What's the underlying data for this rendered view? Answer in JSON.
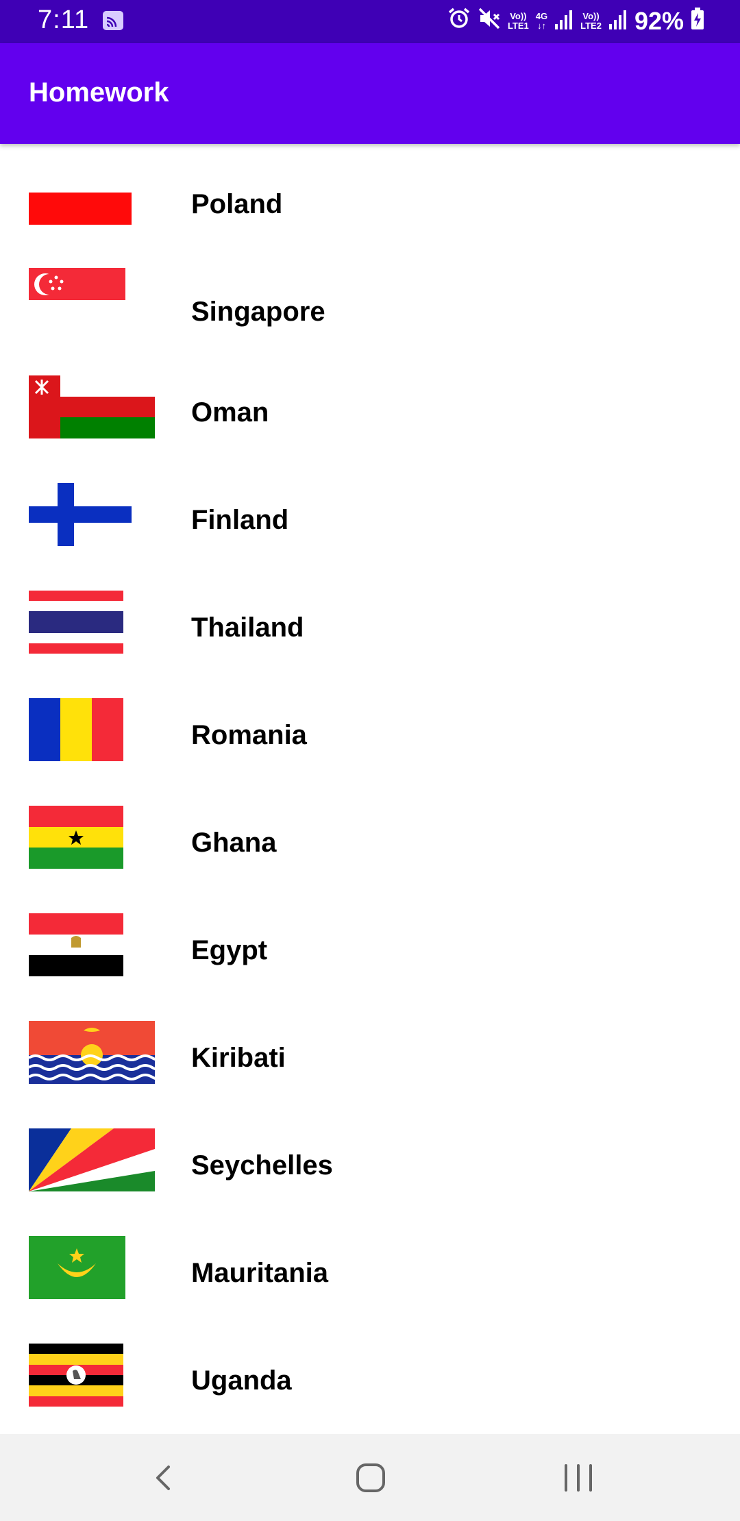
{
  "status_bar": {
    "time": "7:11",
    "battery": "92%",
    "network1_top": "Vo))",
    "network1_bottom": "LTE1",
    "network_type": "4G",
    "network2_top": "Vo))",
    "network2_bottom": "LTE2",
    "icons": [
      "cast-icon",
      "alarm-icon",
      "mute-icon",
      "signal-icon",
      "battery-charging-icon"
    ]
  },
  "app_bar": {
    "title": "Homework"
  },
  "countries": [
    {
      "name": "Poland",
      "flag": "poland-flag-icon"
    },
    {
      "name": "Singapore",
      "flag": "singapore-flag-icon"
    },
    {
      "name": "Oman",
      "flag": "oman-flag-icon"
    },
    {
      "name": "Finland",
      "flag": "finland-flag-icon"
    },
    {
      "name": "Thailand",
      "flag": "thailand-flag-icon"
    },
    {
      "name": "Romania",
      "flag": "romania-flag-icon"
    },
    {
      "name": "Ghana",
      "flag": "ghana-flag-icon"
    },
    {
      "name": "Egypt",
      "flag": "egypt-flag-icon"
    },
    {
      "name": "Kiribati",
      "flag": "kiribati-flag-icon"
    },
    {
      "name": "Seychelles",
      "flag": "seychelles-flag-icon"
    },
    {
      "name": "Mauritania",
      "flag": "mauritania-flag-icon"
    },
    {
      "name": "Uganda",
      "flag": "uganda-flag-icon"
    }
  ],
  "nav_bar": {
    "buttons": [
      "back-icon",
      "home-icon",
      "recents-icon"
    ]
  },
  "colors": {
    "status_bar": "#3f00b5",
    "app_bar": "#6200ee",
    "nav_bar": "#f2f2f2"
  }
}
